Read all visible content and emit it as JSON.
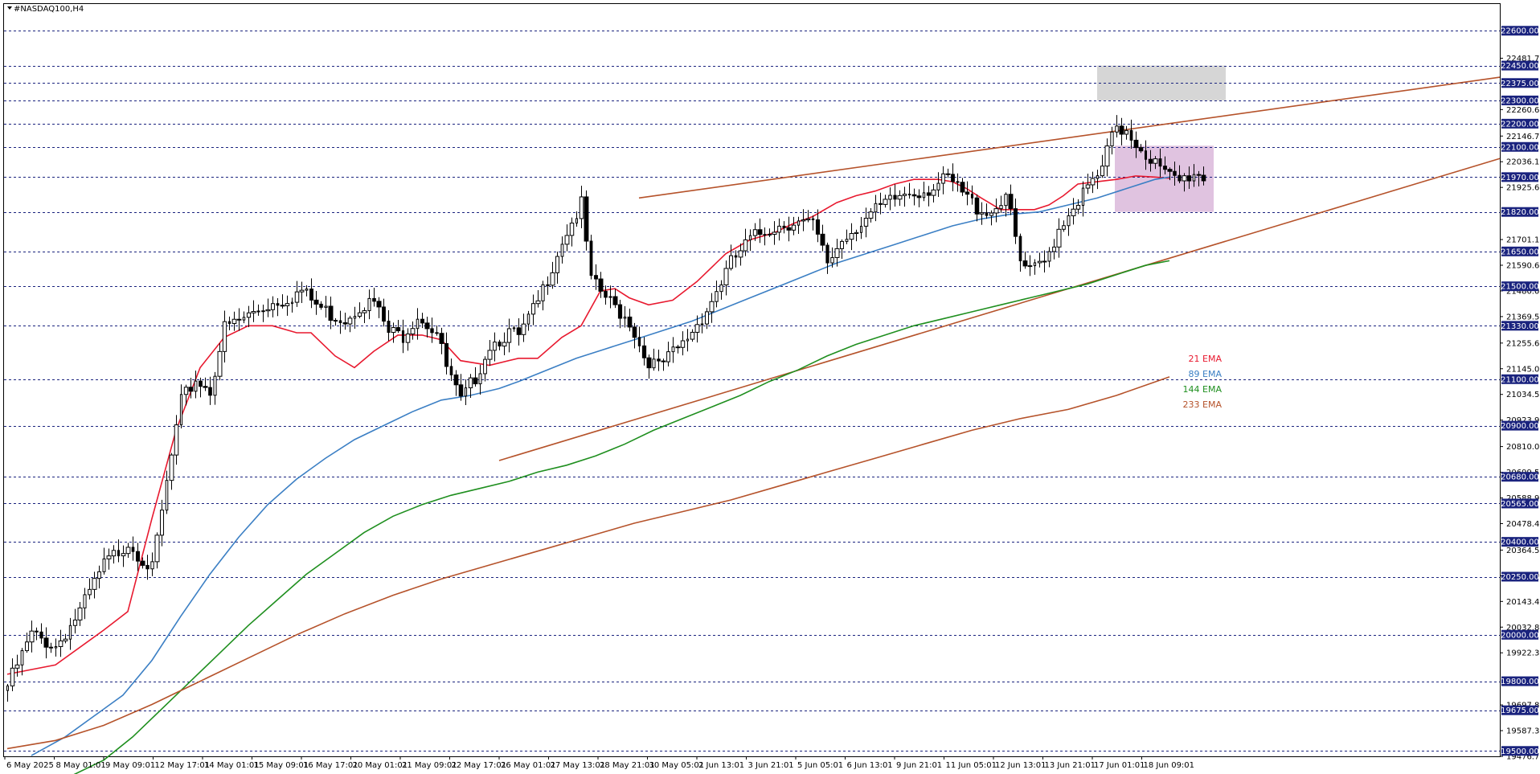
{
  "chart_data": {
    "type": "candlestick",
    "symbol_label": "#NASDAQ100,H4",
    "y_range": [
      19476.77,
      22715
    ],
    "grid": "horizontal dashed level lines",
    "y_ticks": [
      "22481.72",
      "22260.62",
      "22146.72",
      "22036.17",
      "21925.62",
      "21701.17",
      "21590.62",
      "21480.07",
      "21369.52",
      "21255.62",
      "21145.07",
      "21034.52",
      "20923.97",
      "20810.07",
      "20699.52",
      "20588.97",
      "20478.42",
      "20364.52",
      "20253.97",
      "20143.42",
      "20032.87",
      "19922.32",
      "19697.87",
      "19587.32",
      "19476.77"
    ],
    "levels": [
      22600,
      22450,
      22375,
      22300,
      22200,
      22100,
      21970,
      21820,
      21650,
      21500,
      21330,
      21100,
      20900,
      20680,
      20565,
      20400,
      20250,
      20000,
      19800,
      19675,
      19500
    ],
    "level_labels": [
      "22600.00",
      "22450.00",
      "22375.00",
      "22300.00",
      "22200.00",
      "22100.00",
      "21970.00",
      "21820.00",
      "21650.00",
      "21500.00",
      "21330.00",
      "21100.00",
      "20900.00",
      "20680.00",
      "20565.00",
      "20400.00",
      "20250.00",
      "20000.00",
      "19800.00",
      "19675.00",
      "19500.00"
    ],
    "x_labels": [
      "6 May 2025",
      "8 May 01:01",
      "9 May 09:01",
      "12 May 17:01",
      "14 May 01:01",
      "15 May 09:01",
      "16 May 17:01",
      "20 May 01:01",
      "21 May 09:01",
      "22 May 17:01",
      "26 May 01:01",
      "27 May 13:01",
      "28 May 21:01",
      "30 May 05:01",
      "2 Jun 13:01",
      "3 Jun 21:01",
      "5 Jun 05:01",
      "6 Jun 13:01",
      "9 Jun 21:01",
      "11 Jun 05:01",
      "12 Jun 13:01",
      "13 Jun 21:01",
      "17 Jun 01:01",
      "18 Jun 09:01"
    ],
    "candle_count": 150,
    "candle_anchors": [
      [
        0,
        19780
      ],
      [
        5,
        20000
      ],
      [
        10,
        19950
      ],
      [
        15,
        20100
      ],
      [
        20,
        20300
      ],
      [
        25,
        20400
      ],
      [
        30,
        20280
      ],
      [
        33,
        20650
      ],
      [
        36,
        21000
      ],
      [
        39,
        21100
      ],
      [
        42,
        21050
      ],
      [
        45,
        21320
      ],
      [
        48,
        21350
      ],
      [
        52,
        21400
      ],
      [
        55,
        21430
      ],
      [
        58,
        21450
      ],
      [
        61,
        21480
      ],
      [
        64,
        21420
      ],
      [
        67,
        21380
      ],
      [
        70,
        21360
      ],
      [
        73,
        21420
      ],
      [
        76,
        21430
      ],
      [
        79,
        21300
      ],
      [
        82,
        21290
      ],
      [
        85,
        21380
      ],
      [
        89,
        21300
      ],
      [
        91,
        21150
      ],
      [
        94,
        21000
      ],
      [
        97,
        21110
      ],
      [
        100,
        21250
      ],
      [
        104,
        21300
      ],
      [
        106,
        21280
      ],
      [
        110,
        21430
      ],
      [
        115,
        21700
      ],
      [
        119,
        21850
      ],
      [
        121,
        21520
      ],
      [
        125,
        21430
      ],
      [
        129,
        21350
      ],
      [
        132,
        21200
      ],
      [
        135,
        21150
      ],
      [
        140,
        21250
      ],
      [
        145,
        21400
      ],
      [
        150,
        21600
      ],
      [
        154,
        21700
      ],
      [
        158,
        21750
      ],
      [
        163,
        21780
      ],
      [
        167,
        21760
      ],
      [
        170,
        21600
      ],
      [
        173,
        21700
      ],
      [
        177,
        21780
      ],
      [
        182,
        21850
      ],
      [
        186,
        21900
      ],
      [
        191,
        21920
      ],
      [
        195,
        21960
      ],
      [
        198,
        21900
      ],
      [
        201,
        21840
      ],
      [
        204,
        21820
      ],
      [
        207,
        21900
      ],
      [
        210,
        21600
      ],
      [
        212,
        21560
      ],
      [
        215,
        21600
      ],
      [
        218,
        21750
      ],
      [
        221,
        21850
      ],
      [
        224,
        21920
      ],
      [
        227,
        22000
      ],
      [
        229,
        22150
      ],
      [
        232,
        22180
      ],
      [
        234,
        22120
      ],
      [
        237,
        22050
      ],
      [
        240,
        21980
      ],
      [
        243,
        21950
      ],
      [
        246,
        21990
      ],
      [
        248,
        21970
      ]
    ],
    "channel_upper": {
      "from": {
        "x_index": 129,
        "value": 21880
      },
      "to": {
        "x_index": 150,
        "value": 22400
      }
    },
    "channel_lower": {
      "from": {
        "x_index": 101,
        "value": 20750
      },
      "to": {
        "x_index": 150,
        "value": 22050
      }
    },
    "zones": [
      {
        "name": "resistance-zone",
        "top": 22450,
        "bottom": 22300,
        "color": "#d6d6d6"
      },
      {
        "name": "consolidation-box",
        "top": 22105,
        "bottom": 21820,
        "color": "#d8b4d8"
      }
    ],
    "series": [
      {
        "name": "21 EMA",
        "color": "#e8192f",
        "values": [
          [
            0,
            19830
          ],
          [
            10,
            19870
          ],
          [
            20,
            20020
          ],
          [
            25,
            20100
          ],
          [
            30,
            20500
          ],
          [
            35,
            20880
          ],
          [
            40,
            21150
          ],
          [
            45,
            21280
          ],
          [
            50,
            21330
          ],
          [
            55,
            21330
          ],
          [
            60,
            21300
          ],
          [
            63,
            21300
          ],
          [
            68,
            21200
          ],
          [
            72,
            21150
          ],
          [
            76,
            21220
          ],
          [
            81,
            21290
          ],
          [
            86,
            21290
          ],
          [
            90,
            21270
          ],
          [
            94,
            21180
          ],
          [
            100,
            21160
          ],
          [
            106,
            21190
          ],
          [
            110,
            21190
          ],
          [
            115,
            21280
          ],
          [
            119,
            21330
          ],
          [
            123,
            21480
          ],
          [
            126,
            21490
          ],
          [
            129,
            21450
          ],
          [
            133,
            21420
          ],
          [
            138,
            21440
          ],
          [
            143,
            21520
          ],
          [
            149,
            21640
          ],
          [
            154,
            21700
          ],
          [
            159,
            21730
          ],
          [
            163,
            21770
          ],
          [
            167,
            21800
          ],
          [
            172,
            21860
          ],
          [
            176,
            21890
          ],
          [
            180,
            21910
          ],
          [
            184,
            21940
          ],
          [
            188,
            21960
          ],
          [
            193,
            21960
          ],
          [
            196,
            21950
          ],
          [
            199,
            21920
          ],
          [
            202,
            21880
          ],
          [
            206,
            21830
          ],
          [
            210,
            21830
          ],
          [
            213,
            21830
          ],
          [
            216,
            21850
          ],
          [
            219,
            21890
          ],
          [
            222,
            21940
          ],
          [
            226,
            21950
          ],
          [
            230,
            21960
          ],
          [
            234,
            21975
          ],
          [
            238,
            21970
          ],
          [
            241,
            21965
          ]
        ]
      },
      {
        "name": "89 EMA",
        "color": "#3b7fc4",
        "values": [
          [
            5,
            19480
          ],
          [
            12,
            19560
          ],
          [
            18,
            19650
          ],
          [
            24,
            19740
          ],
          [
            30,
            19890
          ],
          [
            36,
            20080
          ],
          [
            42,
            20260
          ],
          [
            48,
            20420
          ],
          [
            54,
            20560
          ],
          [
            60,
            20670
          ],
          [
            66,
            20760
          ],
          [
            72,
            20840
          ],
          [
            78,
            20900
          ],
          [
            84,
            20960
          ],
          [
            90,
            21010
          ],
          [
            96,
            21030
          ],
          [
            102,
            21060
          ],
          [
            106,
            21090
          ],
          [
            112,
            21140
          ],
          [
            118,
            21190
          ],
          [
            124,
            21230
          ],
          [
            130,
            21270
          ],
          [
            136,
            21310
          ],
          [
            142,
            21350
          ],
          [
            148,
            21400
          ],
          [
            154,
            21450
          ],
          [
            160,
            21500
          ],
          [
            166,
            21550
          ],
          [
            172,
            21600
          ],
          [
            178,
            21640
          ],
          [
            184,
            21680
          ],
          [
            190,
            21720
          ],
          [
            196,
            21760
          ],
          [
            202,
            21790
          ],
          [
            208,
            21810
          ],
          [
            214,
            21820
          ],
          [
            220,
            21850
          ],
          [
            226,
            21880
          ],
          [
            232,
            21920
          ],
          [
            238,
            21960
          ],
          [
            241,
            21970
          ]
        ]
      },
      {
        "name": "144 EMA",
        "color": "#1f8f1f",
        "values": [
          [
            10,
            19360
          ],
          [
            20,
            19460
          ],
          [
            26,
            19560
          ],
          [
            32,
            19680
          ],
          [
            38,
            19800
          ],
          [
            44,
            19920
          ],
          [
            50,
            20040
          ],
          [
            56,
            20150
          ],
          [
            62,
            20260
          ],
          [
            68,
            20350
          ],
          [
            74,
            20440
          ],
          [
            80,
            20510
          ],
          [
            86,
            20560
          ],
          [
            92,
            20600
          ],
          [
            98,
            20630
          ],
          [
            104,
            20660
          ],
          [
            110,
            20700
          ],
          [
            116,
            20730
          ],
          [
            122,
            20770
          ],
          [
            128,
            20820
          ],
          [
            134,
            20880
          ],
          [
            140,
            20930
          ],
          [
            146,
            20980
          ],
          [
            152,
            21030
          ],
          [
            158,
            21090
          ],
          [
            164,
            21140
          ],
          [
            170,
            21200
          ],
          [
            176,
            21250
          ],
          [
            182,
            21290
          ],
          [
            188,
            21330
          ],
          [
            194,
            21360
          ],
          [
            200,
            21390
          ],
          [
            206,
            21420
          ],
          [
            212,
            21450
          ],
          [
            218,
            21480
          ],
          [
            224,
            21510
          ],
          [
            230,
            21550
          ],
          [
            236,
            21590
          ],
          [
            241,
            21610
          ]
        ]
      },
      {
        "name": "233 EMA",
        "color": "#b5522a",
        "values": [
          [
            0,
            19510
          ],
          [
            10,
            19545
          ],
          [
            20,
            19610
          ],
          [
            30,
            19700
          ],
          [
            40,
            19800
          ],
          [
            50,
            19900
          ],
          [
            60,
            20000
          ],
          [
            70,
            20090
          ],
          [
            80,
            20170
          ],
          [
            90,
            20240
          ],
          [
            100,
            20300
          ],
          [
            110,
            20360
          ],
          [
            120,
            20420
          ],
          [
            130,
            20480
          ],
          [
            140,
            20530
          ],
          [
            150,
            20580
          ],
          [
            160,
            20640
          ],
          [
            170,
            20700
          ],
          [
            180,
            20760
          ],
          [
            190,
            20820
          ],
          [
            200,
            20880
          ],
          [
            210,
            20930
          ],
          [
            220,
            20970
          ],
          [
            230,
            21030
          ],
          [
            241,
            21110
          ]
        ]
      }
    ],
    "legend": [
      "21 EMA",
      "89 EMA",
      "144 EMA",
      "233 EMA"
    ],
    "legend_placement": "right-middle"
  }
}
